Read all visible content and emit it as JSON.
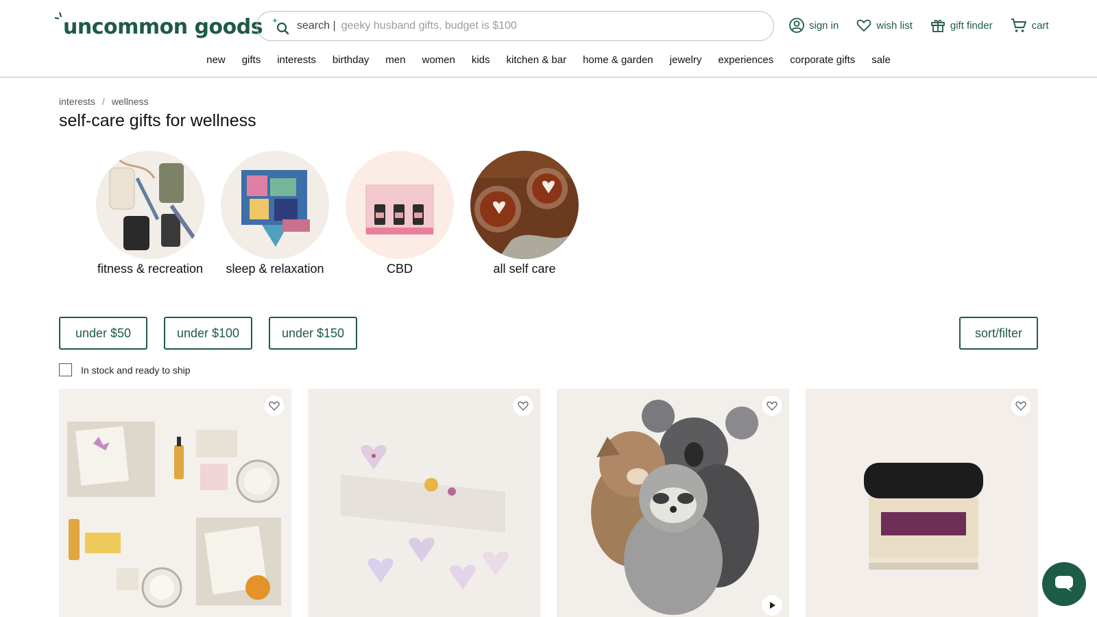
{
  "brand": {
    "name": "uncommon goods",
    "color": "#1e5a47"
  },
  "search": {
    "prefix": "search |",
    "placeholder": "geeky husband gifts, budget is $100"
  },
  "utility_nav": [
    {
      "label": "sign in",
      "icon": "user-circle-icon"
    },
    {
      "label": "wish list",
      "icon": "heart-icon"
    },
    {
      "label": "gift finder",
      "icon": "gift-icon"
    },
    {
      "label": "cart",
      "icon": "cart-icon"
    }
  ],
  "main_nav": [
    "new",
    "gifts",
    "interests",
    "birthday",
    "men",
    "women",
    "kids",
    "kitchen & bar",
    "home & garden",
    "jewelry",
    "experiences",
    "corporate gifts",
    "sale"
  ],
  "breadcrumb": [
    "interests",
    "wellness"
  ],
  "breadcrumb_separator": "/",
  "page_title": "self-care gifts for wellness",
  "categories": [
    {
      "label": "fitness & recreation"
    },
    {
      "label": "sleep & relaxation"
    },
    {
      "label": "CBD"
    },
    {
      "label": "all self care"
    }
  ],
  "price_filters": [
    "under $50",
    "under $100",
    "under $150"
  ],
  "sort_filter_label": "sort/filter",
  "stock_filter": {
    "label": "In stock and ready to ship",
    "checked": false
  },
  "products": [
    {
      "image": "self-care-kit-floral-boxes",
      "has_video": false
    },
    {
      "image": "heart-bath-bombs-set",
      "has_video": false
    },
    {
      "image": "weighted-plush-animals",
      "has_video": true
    },
    {
      "image": "magnesium-body-butter-jar",
      "has_video": false
    }
  ],
  "chat": {
    "icon": "chat-bubble-icon"
  }
}
